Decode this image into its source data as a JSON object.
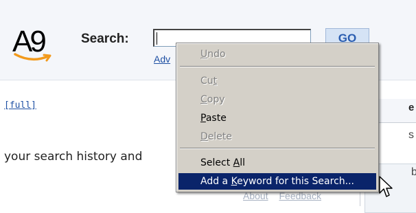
{
  "header": {
    "logo_text": "A9",
    "search_label": "Search:",
    "search_value": "",
    "go_label": "GO",
    "advanced_link": "Adv"
  },
  "content": {
    "full_link": "[full]",
    "history_text": "your search history and"
  },
  "right_panel": {
    "header_fragment": "e",
    "fragment_s": "s",
    "fragment_box": "bo"
  },
  "footer": {
    "about": "About",
    "feedback": "Feedback"
  },
  "context_menu": {
    "items": [
      {
        "label": "Undo",
        "accel": "U",
        "enabled": false
      },
      {
        "label": "Cut",
        "accel": "t",
        "enabled": false
      },
      {
        "label": "Copy",
        "accel": "C",
        "enabled": false
      },
      {
        "label": "Paste",
        "accel": "P",
        "enabled": true
      },
      {
        "label": "Delete",
        "accel": "D",
        "enabled": false
      },
      {
        "label": "Select All",
        "accel": "A",
        "enabled": true
      },
      {
        "label": "Add a Keyword for this Search...",
        "accel": "K",
        "enabled": true,
        "highlighted": true
      }
    ]
  },
  "colors": {
    "menu_bg": "#d4d0c8",
    "menu_highlight": "#0a246a",
    "link": "#1d4fa3",
    "go_button_bg": "#d5e3f5"
  }
}
